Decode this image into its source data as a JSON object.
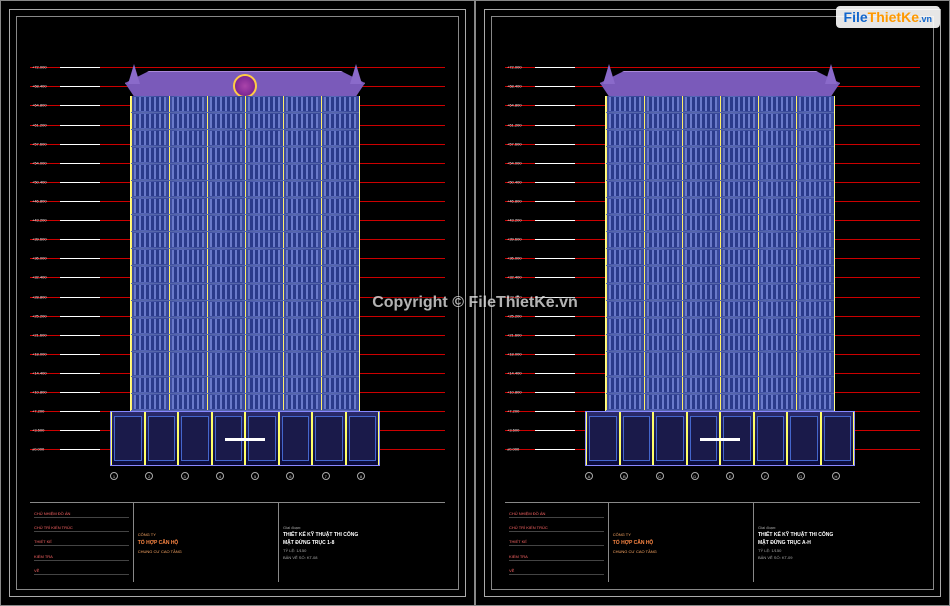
{
  "watermark_center": "Copyright © FileThietKe.vn",
  "watermark_logo": {
    "part1": "File",
    "part2": "ThietKe",
    "suffix": ".vn"
  },
  "sheets": [
    {
      "levels": [
        "+72.000",
        "+68.400",
        "+64.800",
        "+61.200",
        "+57.600",
        "+54.000",
        "+50.400",
        "+46.800",
        "+43.200",
        "+39.600",
        "+36.000",
        "+32.400",
        "+28.800",
        "+25.200",
        "+21.600",
        "+18.000",
        "+14.400",
        "+10.800",
        "+7.200",
        "+3.600",
        "±0.000"
      ],
      "grids": [
        "1",
        "2",
        "3",
        "4",
        "5",
        "6",
        "7",
        "8"
      ],
      "title_block": {
        "approvals": [
          "CHỦ NHIỆM ĐỒ ÁN",
          "CHỦ TRÌ KIẾN TRÚC",
          "THIẾT KẾ",
          "KIỂM TRA",
          "VẼ"
        ],
        "company": "CÔNG TY",
        "project": "TỔ HỢP CĂN HỘ",
        "project_sub": "CHUNG CƯ CAO TẦNG",
        "doc_phase": "Giai đoạn:",
        "doc_phase_val": "THIẾT KẾ KỸ THUẬT THI CÔNG",
        "drawing_title": "MẶT ĐỨNG TRỤC 1-8",
        "scale_label": "TỶ LỆ: 1/150",
        "sheet_label": "BẢN VẼ SỐ:",
        "sheet_no": "KT-08"
      },
      "logo_visible": true
    },
    {
      "levels": [
        "+72.000",
        "+68.400",
        "+64.800",
        "+61.200",
        "+57.600",
        "+54.000",
        "+50.400",
        "+46.800",
        "+43.200",
        "+39.600",
        "+36.000",
        "+32.400",
        "+28.800",
        "+25.200",
        "+21.600",
        "+18.000",
        "+14.400",
        "+10.800",
        "+7.200",
        "+3.600",
        "±0.000"
      ],
      "grids": [
        "A",
        "B",
        "C",
        "D",
        "E",
        "F",
        "G",
        "H"
      ],
      "title_block": {
        "approvals": [
          "CHỦ NHIỆM ĐỒ ÁN",
          "CHỦ TRÌ KIẾN TRÚC",
          "THIẾT KẾ",
          "KIỂM TRA",
          "VẼ"
        ],
        "company": "CÔNG TY",
        "project": "TỔ HỢP CĂN HỘ",
        "project_sub": "CHUNG CƯ CAO TẦNG",
        "doc_phase": "Giai đoạn:",
        "doc_phase_val": "THIẾT KẾ KỸ THUẬT THI CÔNG",
        "drawing_title": "MẶT ĐỨNG TRỤC A-H",
        "scale_label": "TỶ LỆ: 1/150",
        "sheet_label": "BẢN VẼ SỐ:",
        "sheet_no": "KT-09"
      },
      "logo_visible": false
    }
  ],
  "building": {
    "tower_floors": 18,
    "podium_bays": 8,
    "tower_bays": 6
  }
}
